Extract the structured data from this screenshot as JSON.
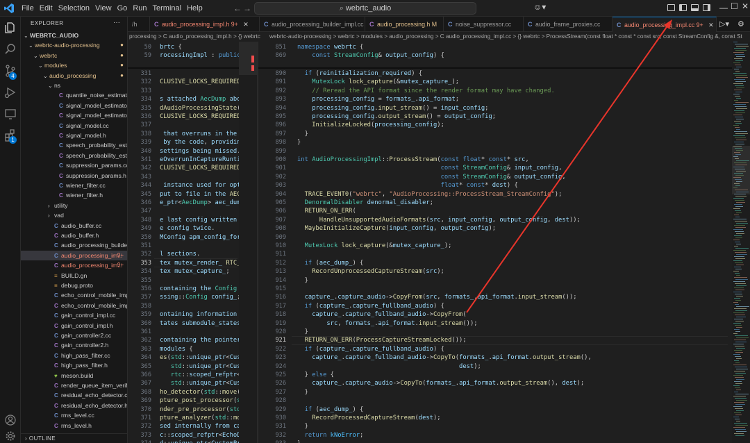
{
  "menu": [
    "File",
    "Edit",
    "Selection",
    "View",
    "Go",
    "Run",
    "Terminal",
    "Help"
  ],
  "search": {
    "text": "webrtc_audio"
  },
  "explorer": {
    "title": "EXPLORER",
    "outline": "OUTLINE",
    "rows": [
      {
        "label": "WEBRTC_AUDIO",
        "depth": 0,
        "kind": "root"
      },
      {
        "label": "webrtc-audio-processing",
        "depth": 1,
        "kind": "folder",
        "status": "mod"
      },
      {
        "label": "webrtc",
        "depth": 2,
        "kind": "folder",
        "status": "mod"
      },
      {
        "label": "modules",
        "depth": 3,
        "kind": "folder",
        "status": "mod"
      },
      {
        "label": "audio_processing",
        "depth": 4,
        "kind": "folder",
        "status": "mod"
      },
      {
        "label": "ns",
        "depth": 5,
        "kind": "folder"
      },
      {
        "label": "quantile_noise_estimator.h",
        "depth": 6,
        "kind": "h"
      },
      {
        "label": "signal_model_estimator.cc",
        "depth": 6,
        "kind": "c"
      },
      {
        "label": "signal_model_estimator.h",
        "depth": 6,
        "kind": "h"
      },
      {
        "label": "signal_model.cc",
        "depth": 6,
        "kind": "c"
      },
      {
        "label": "signal_model.h",
        "depth": 6,
        "kind": "h"
      },
      {
        "label": "speech_probability_estima...",
        "depth": 6,
        "kind": "c"
      },
      {
        "label": "speech_probability_estima...",
        "depth": 6,
        "kind": "h"
      },
      {
        "label": "suppression_params.cc",
        "depth": 6,
        "kind": "c"
      },
      {
        "label": "suppression_params.h",
        "depth": 6,
        "kind": "h"
      },
      {
        "label": "wiener_filter.cc",
        "depth": 6,
        "kind": "c"
      },
      {
        "label": "wiener_filter.h",
        "depth": 6,
        "kind": "h"
      },
      {
        "label": "utility",
        "depth": 5,
        "kind": "folder-closed"
      },
      {
        "label": "vad",
        "depth": 5,
        "kind": "folder-closed"
      },
      {
        "label": "audio_buffer.cc",
        "depth": 5,
        "kind": "c"
      },
      {
        "label": "audio_buffer.h",
        "depth": 5,
        "kind": "h"
      },
      {
        "label": "audio_processing_builder_i...",
        "depth": 5,
        "kind": "c"
      },
      {
        "label": "audio_processing_im...",
        "depth": 5,
        "kind": "c",
        "status": "err",
        "badge": "9+",
        "selected": true
      },
      {
        "label": "audio_processing_im...",
        "depth": 5,
        "kind": "h",
        "status": "err",
        "badge": "9+"
      },
      {
        "label": "BUILD.gn",
        "depth": 5,
        "kind": "g"
      },
      {
        "label": "debug.proto",
        "depth": 5,
        "kind": "p"
      },
      {
        "label": "echo_control_mobile_impl.cc",
        "depth": 5,
        "kind": "c"
      },
      {
        "label": "echo_control_mobile_impl.h",
        "depth": 5,
        "kind": "h"
      },
      {
        "label": "gain_control_impl.cc",
        "depth": 5,
        "kind": "c"
      },
      {
        "label": "gain_control_impl.h",
        "depth": 5,
        "kind": "h"
      },
      {
        "label": "gain_controller2.cc",
        "depth": 5,
        "kind": "c"
      },
      {
        "label": "gain_controller2.h",
        "depth": 5,
        "kind": "h"
      },
      {
        "label": "high_pass_filter.cc",
        "depth": 5,
        "kind": "c"
      },
      {
        "label": "high_pass_filter.h",
        "depth": 5,
        "kind": "h"
      },
      {
        "label": "meson.build",
        "depth": 5,
        "kind": "m"
      },
      {
        "label": "render_queue_item_verifier.h",
        "depth": 5,
        "kind": "h"
      },
      {
        "label": "residual_echo_detector.cc",
        "depth": 5,
        "kind": "c"
      },
      {
        "label": "residual_echo_detector.h",
        "depth": 5,
        "kind": "h"
      },
      {
        "label": "rms_level.cc",
        "depth": 5,
        "kind": "c"
      },
      {
        "label": "rms_level.h",
        "depth": 5,
        "kind": "h"
      }
    ]
  },
  "tabs": [
    {
      "label": "/h",
      "kind": "none"
    },
    {
      "label": "audio_processing_impl.h 9+",
      "kind": "h",
      "status": "err"
    },
    {
      "label": "audio_processing_builder_impl.cc",
      "kind": "c"
    },
    {
      "label": "audio_processing.h M",
      "kind": "h",
      "status": "mod"
    },
    {
      "label": "noise_suppressor.cc",
      "kind": "c"
    },
    {
      "label": "audio_frame_proxies.cc",
      "kind": "c"
    },
    {
      "label": "audio_processing_impl.cc 9+",
      "kind": "c",
      "status": "err",
      "active": true
    }
  ],
  "breadcrumbs": {
    "left": "processing > C audio_processing_impl.h > {} webrtc",
    "right": "webrtc-audio-processing > webrtc > modules > audio_processing > C audio_processing_impl.cc > {} webrtc > ProcessStream(const float * const * const src, const StreamConfig &, const St"
  },
  "left_pane": {
    "sticky_numbers": [
      "50",
      "59"
    ],
    "sticky_lines": [
      "brtc {",
      "rocessingImpl : public AU"
    ],
    "numbers": [
      "331",
      "332",
      "333",
      "334",
      "335",
      "336",
      "337",
      "338",
      "339",
      "340",
      "341",
      "342",
      "343",
      "344",
      "345",
      "346",
      "347",
      "348",
      "349",
      "350",
      "351",
      "352",
      "353",
      "354",
      "355",
      "356",
      "357",
      "358",
      "359",
      "360",
      "361",
      "362",
      "363",
      "364",
      "365",
      "366",
      "367",
      "368",
      "369",
      "370",
      "371",
      "372",
      "373",
      "374",
      "375"
    ],
    "current_line": "353",
    "lines": [
      "",
      "CLUSIVE_LOCKS_REQUIRED(mu",
      "",
      "s attached AecDump about",
      "dAudioProcessingState()",
      "CLUSIVE_LOCKS_REQUIRED(mu",
      "",
      " that overruns in the cas",
      " by the code, providing s",
      "settings being missed.",
      "eOverrunInCaptureRuntimeS",
      "CLUSIVE_LOCKS_REQUIRED(mu",
      "",
      " instance used for option",
      "put to file in the AEC-du",
      "e_ptr<AecDump> aec_dump_",
      "",
      "e last config written wit",
      "e config twice.",
      "MConfig apm_config_for_ae",
      "",
      "l sections.",
      "tex mutex_render_ RTC_ACQ",
      "tex mutex_capture_;",
      "",
      "containing the Config spe",
      "ssing::Config config_;",
      "",
      "ontaining information abo",
      "tates submodule_states_;",
      "",
      "containing the pointers t",
      "modules {",
      "es(std::unique_ptr<Custom",
      "   std::unique_ptr<Custom",
      "   rtc::scoped_refptr<Ech",
      "   std::unique_ptr<Custom",
      "ho_detector(std::move(ech",
      "pture_post_processor(std:",
      "nder_pre_processor(std::m",
      "pture_analyzer(std::move(",
      "sed internally from captu",
      "c::scoped_refptr<EchoDete",
      "d::unique_ptr<CustomProce",
      "d::unique_ptr<CustomProce"
    ]
  },
  "right_pane": {
    "sticky_numbers": [
      "851",
      "869"
    ],
    "sticky_lines": [
      "namespace webrtc {",
      "    const StreamConfig& output_config) {"
    ],
    "numbers": [
      "890",
      "891",
      "892",
      "893",
      "894",
      "895",
      "896",
      "897",
      "898",
      "899",
      "900",
      "901",
      "902",
      "903",
      "904",
      "905",
      "906",
      "907",
      "908",
      "909",
      "910",
      "911",
      "912",
      "913",
      "914",
      "915",
      "916",
      "917",
      "918",
      "919",
      "920",
      "921",
      "922",
      "923",
      "924",
      "925",
      "926",
      "927",
      "928",
      "929",
      "930",
      "931",
      "932",
      "933"
    ],
    "current_line": "921",
    "lines": [
      "  if (reinitialization_required) {",
      "    MutexLock lock_capture(&mutex_capture_);",
      "    // Reread the API format since the render format may have changed.",
      "    processing_config = formats_.api_format;",
      "    processing_config.input_stream() = input_config;",
      "    processing_config.output_stream() = output_config;",
      "    InitializeLocked(processing_config);",
      "  }",
      "}",
      "",
      "int AudioProcessingImpl::ProcessStream(const float* const* src,",
      "                                       const StreamConfig& input_config,",
      "                                       const StreamConfig& output_config,",
      "                                       float* const* dest) {",
      "  TRACE_EVENT0(\"webrtc\", \"AudioProcessing::ProcessStream_StreamConfig\");",
      "  DenormalDisabler denormal_disabler;",
      "  RETURN_ON_ERR(",
      "      HandleUnsupportedAudioFormats(src, input_config, output_config, dest));",
      "  MaybeInitializeCapture(input_config, output_config);",
      "",
      "  MutexLock lock_capture(&mutex_capture_);",
      "",
      "  if (aec_dump_) {",
      "    RecordUnprocessedCaptureStream(src);",
      "  }",
      "",
      "  capture_.capture_audio->CopyFrom(src, formats_.api_format.input_stream());",
      "  if (capture_.capture_fullband_audio) {",
      "    capture_.capture_fullband_audio->CopyFrom(",
      "        src, formats_.api_format.input_stream());",
      "  }",
      "  RETURN_ON_ERR(ProcessCaptureStreamLocked());",
      "  if (capture_.capture_fullband_audio) {",
      "    capture_.capture_fullband_audio->CopyTo(formats_.api_format.output_stream(),",
      "                                            dest);",
      "  } else {",
      "    capture_.capture_audio->CopyTo(formats_.api_format.output_stream(), dest);",
      "  }",
      "",
      "  if (aec_dump_) {",
      "    RecordProcessedCaptureStream(dest);",
      "  }",
      "  return kNoError;",
      "}"
    ]
  },
  "badges": {
    "source_control": "4",
    "extensions": "1"
  },
  "colors": {
    "accent": "#0078d4",
    "arrow": "#e8352b",
    "error": "#f48771",
    "modified": "#e2c08d"
  }
}
